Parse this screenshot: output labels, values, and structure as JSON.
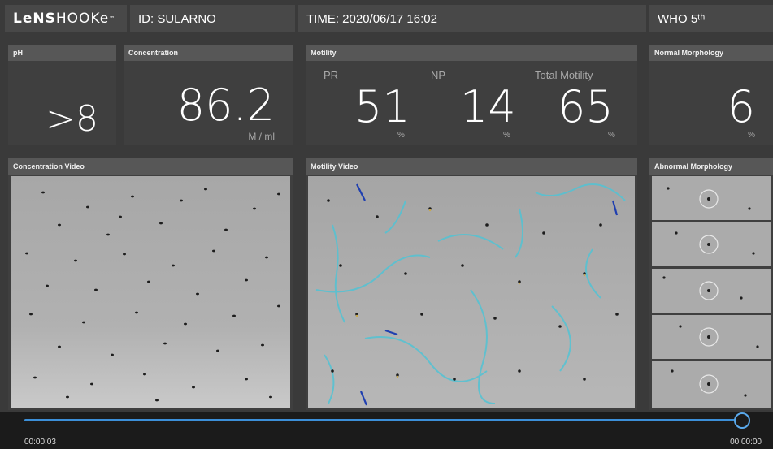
{
  "header": {
    "logo_prefix": "LeNS",
    "logo_suffix": "HOOKe",
    "logo_mark": "™",
    "id_text": "ID: SULARNO",
    "time_text": "TIME: 2020/06/17  16:02",
    "standard": "WHO 5ᵗʰ"
  },
  "ph": {
    "title": "pH",
    "value": ">8"
  },
  "concentration": {
    "title": "Concentration",
    "value": "86.2",
    "unit": "M / ml"
  },
  "motility": {
    "title": "Motility",
    "pr_label": "PR",
    "pr_value": "51",
    "pr_unit": "%",
    "np_label": "NP",
    "np_value": "14",
    "np_unit": "%",
    "total_label": "Total Motility",
    "total_value": "65",
    "total_unit": "%"
  },
  "normal_morphology": {
    "title": "Normal Morphology",
    "value": "6",
    "unit": "%"
  },
  "videos": {
    "concentration_title": "Concentration Video",
    "motility_title": "Motility Video",
    "abnormal_title": "Abnormal Morphology"
  },
  "player": {
    "elapsed": "00:00:03",
    "remaining": "00:00:00",
    "progress": 0.99,
    "accent": "#3c8fd8"
  },
  "icons": {
    "play_knob": "scrubber-knob-icon"
  }
}
